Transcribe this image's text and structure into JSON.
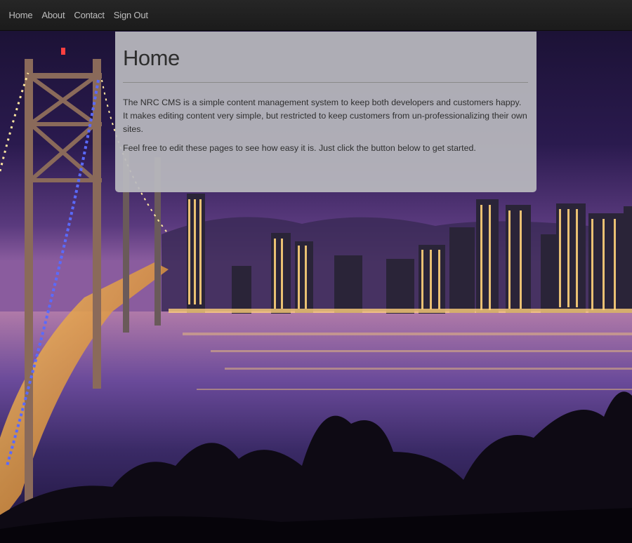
{
  "nav": {
    "items": [
      {
        "label": "Home"
      },
      {
        "label": "About"
      },
      {
        "label": "Contact"
      },
      {
        "label": "Sign Out"
      }
    ]
  },
  "content": {
    "title": "Home",
    "paragraphs": [
      "The NRC CMS is a simple content management system to keep both developers and customers happy. It makes editing content very simple, but restricted to keep customers from un-professionalizing their own sites.",
      "Feel free to edit these pages to see how easy it is. Just click the button below to get started."
    ]
  },
  "background": {
    "scene": "San Francisco Bay Bridge and city skyline at night"
  }
}
